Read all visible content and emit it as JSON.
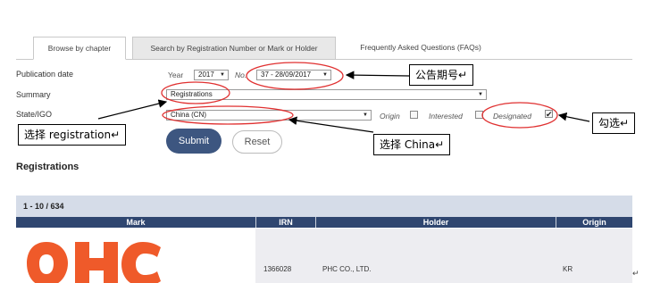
{
  "tabs": [
    {
      "label": "Browse by chapter",
      "active": true
    },
    {
      "label": "Search by Registration Number or Mark or Holder",
      "active": false
    },
    {
      "label": "Frequently Asked Questions (FAQs)",
      "active": false
    }
  ],
  "form": {
    "publication_date_label": "Publication date",
    "year_label": "Year",
    "year_value": "2017",
    "no_label": "No.",
    "no_value": "37 - 28/09/2017",
    "summary_label": "Summary",
    "summary_value": "Registrations",
    "state_label": "State/IGO",
    "state_value": "China (CN)",
    "origin_label": "Origin",
    "interested_label": "Interested",
    "designated_label": "Designated",
    "interested_checked": false,
    "designated_checked": true,
    "submit_label": "Submit",
    "reset_label": "Reset"
  },
  "section_heading": "Registrations",
  "results": {
    "count_text": "1 - 10 / 634",
    "columns": [
      "Mark",
      "IRN",
      "Holder",
      "Origin"
    ],
    "rows": [
      {
        "mark_logo_text": "PHC",
        "irn": "1366028",
        "holder": "PHC CO., LTD.",
        "origin": "KR"
      }
    ]
  },
  "annotations": {
    "gazette_issue": "公告期号",
    "select_registration": "选择 registration",
    "select_china": "选择 China",
    "tick": "勾选"
  },
  "colors": {
    "header_navy": "#2f4670",
    "result_bar": "#d5dce8",
    "submit_button": "#3d5680",
    "annotation_red": "#e03030",
    "logo_orange": "#ef5a2a"
  }
}
